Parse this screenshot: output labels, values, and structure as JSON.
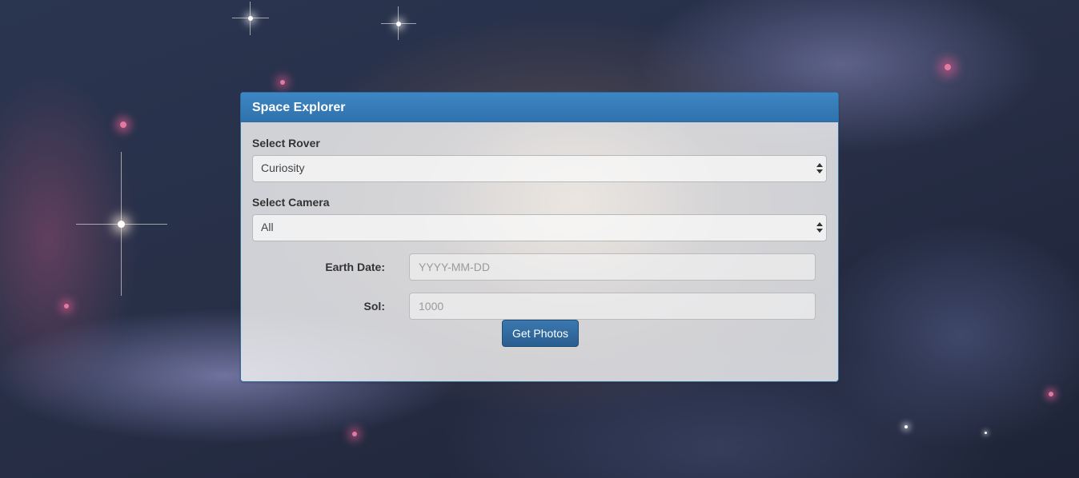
{
  "app": {
    "panel_title": "Space Explorer"
  },
  "form": {
    "rover_label": "Select Rover",
    "rover_value": "Curiosity",
    "camera_label": "Select Camera",
    "camera_value": "All",
    "earth_date_label": "Earth Date:",
    "earth_date_placeholder": "YYYY-MM-DD",
    "sol_label": "Sol:",
    "sol_placeholder": "1000",
    "submit_label": "Get Photos"
  },
  "colors": {
    "panel_heading": "#337ab7",
    "button": "#2f6aa0",
    "background": "#283048"
  },
  "icons": {
    "select_arrows": "updown-arrows-icon"
  }
}
